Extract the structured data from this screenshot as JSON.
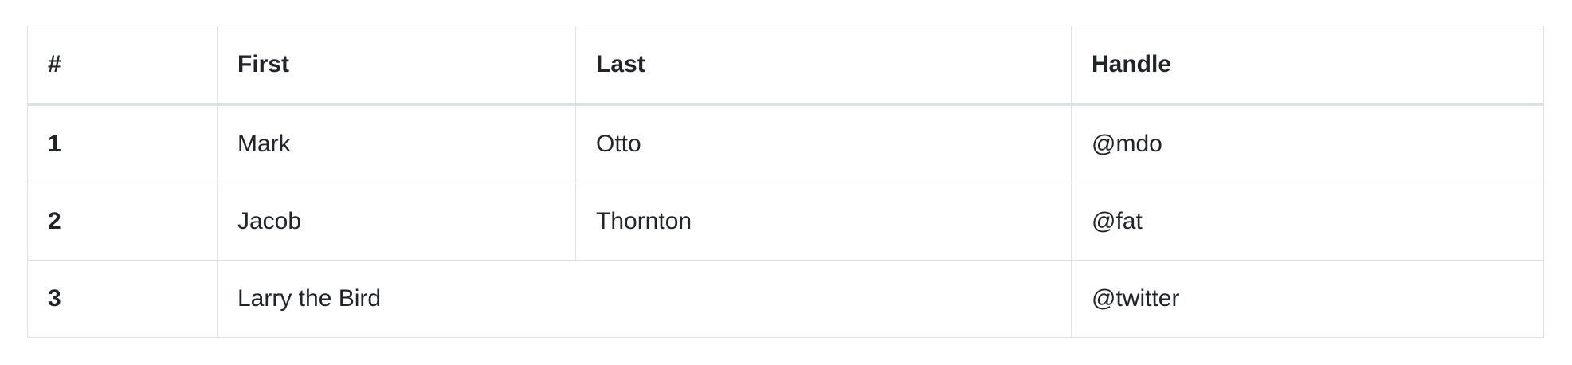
{
  "table": {
    "headers": [
      "#",
      "First",
      "Last",
      "Handle"
    ],
    "rows": [
      {
        "index": "1",
        "first": "Mark",
        "last": "Otto",
        "handle": "@mdo"
      },
      {
        "index": "2",
        "first": "Jacob",
        "last": "Thornton",
        "handle": "@fat"
      },
      {
        "index": "3",
        "first_last": "Larry the Bird",
        "handle": "@twitter"
      }
    ]
  },
  "colors": {
    "text": "#212529",
    "border": "#dee2e6",
    "background": "#ffffff"
  }
}
